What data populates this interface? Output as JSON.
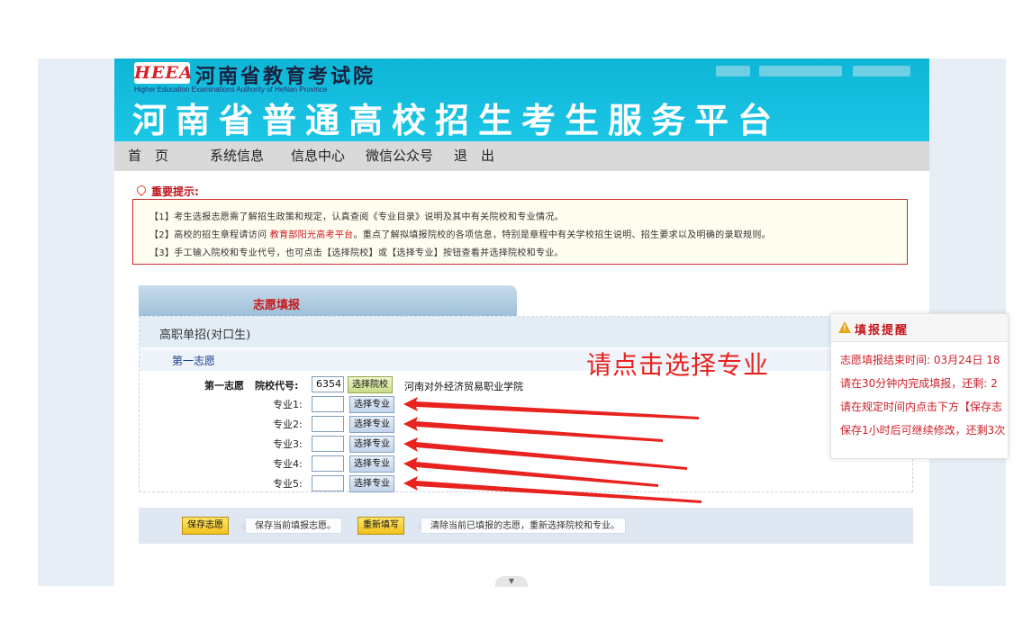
{
  "header": {
    "logo": "HEEA",
    "org_name": "河南省教育考试院",
    "org_name_en": "Higher Education Examinations Authority of HeNan Province",
    "platform_title": "河南省普通高校招生考生服务平台"
  },
  "nav": {
    "items": [
      {
        "label": "首　页"
      },
      {
        "label": "系统信息"
      },
      {
        "label": "信息中心"
      },
      {
        "label": "微信公众号"
      },
      {
        "label": "退　出"
      }
    ]
  },
  "notice": {
    "title": "重要提示:",
    "line1": "【1】考生选报志愿需了解招生政策和规定，认真查阅《专业目录》说明及其中有关院校和专业情况。",
    "line2_pre": "【2】高校的招生章程请访问",
    "line2_link": "教育部阳光高考平台",
    "line2_post": "。重点了解拟填报院校的各项信息，特别是章程中有关学校招生说明、招生要求以及明确的录取规则。",
    "line3": "【3】手工输入院校和专业代号，也可点击【选择院校】或【选择专业】按钮查看并选择院校和专业。"
  },
  "form": {
    "tab_label": "志愿填报",
    "category": "高职单招(对口生)",
    "choice_header": "第一志愿",
    "choice_label": "第一志愿",
    "school_code_label": "院校代号:",
    "school_code_value": "6354",
    "select_school_button": "选择院校",
    "school_name": "河南对外经济贸易职业学院",
    "majors": [
      {
        "label": "专业1:",
        "value": "",
        "button": "选择专业"
      },
      {
        "label": "专业2:",
        "value": "",
        "button": "选择专业"
      },
      {
        "label": "专业3:",
        "value": "",
        "button": "选择专业"
      },
      {
        "label": "专业4:",
        "value": "",
        "button": "选择专业"
      },
      {
        "label": "专业5:",
        "value": "",
        "button": "选择专业"
      }
    ]
  },
  "annotation": {
    "callout": "请点击选择专业",
    "color": "#e8231f"
  },
  "reminder": {
    "title": "填报提醒",
    "line1": "志愿填报结束时间: 03月24日 18",
    "line2": "请在30分钟内完成填报，还剩: 2",
    "line3": "请在规定时间内点击下方【保存志",
    "line4": "保存1小时后可继续修改，还剩3次"
  },
  "bottom": {
    "save_button": "保存志愿",
    "save_hint": "保存当前填报志愿。",
    "reset_button": "重新填写",
    "reset_hint": "清除当前已填报的志愿，重新选择院校和专业。"
  },
  "scroll_glyph": "▼"
}
